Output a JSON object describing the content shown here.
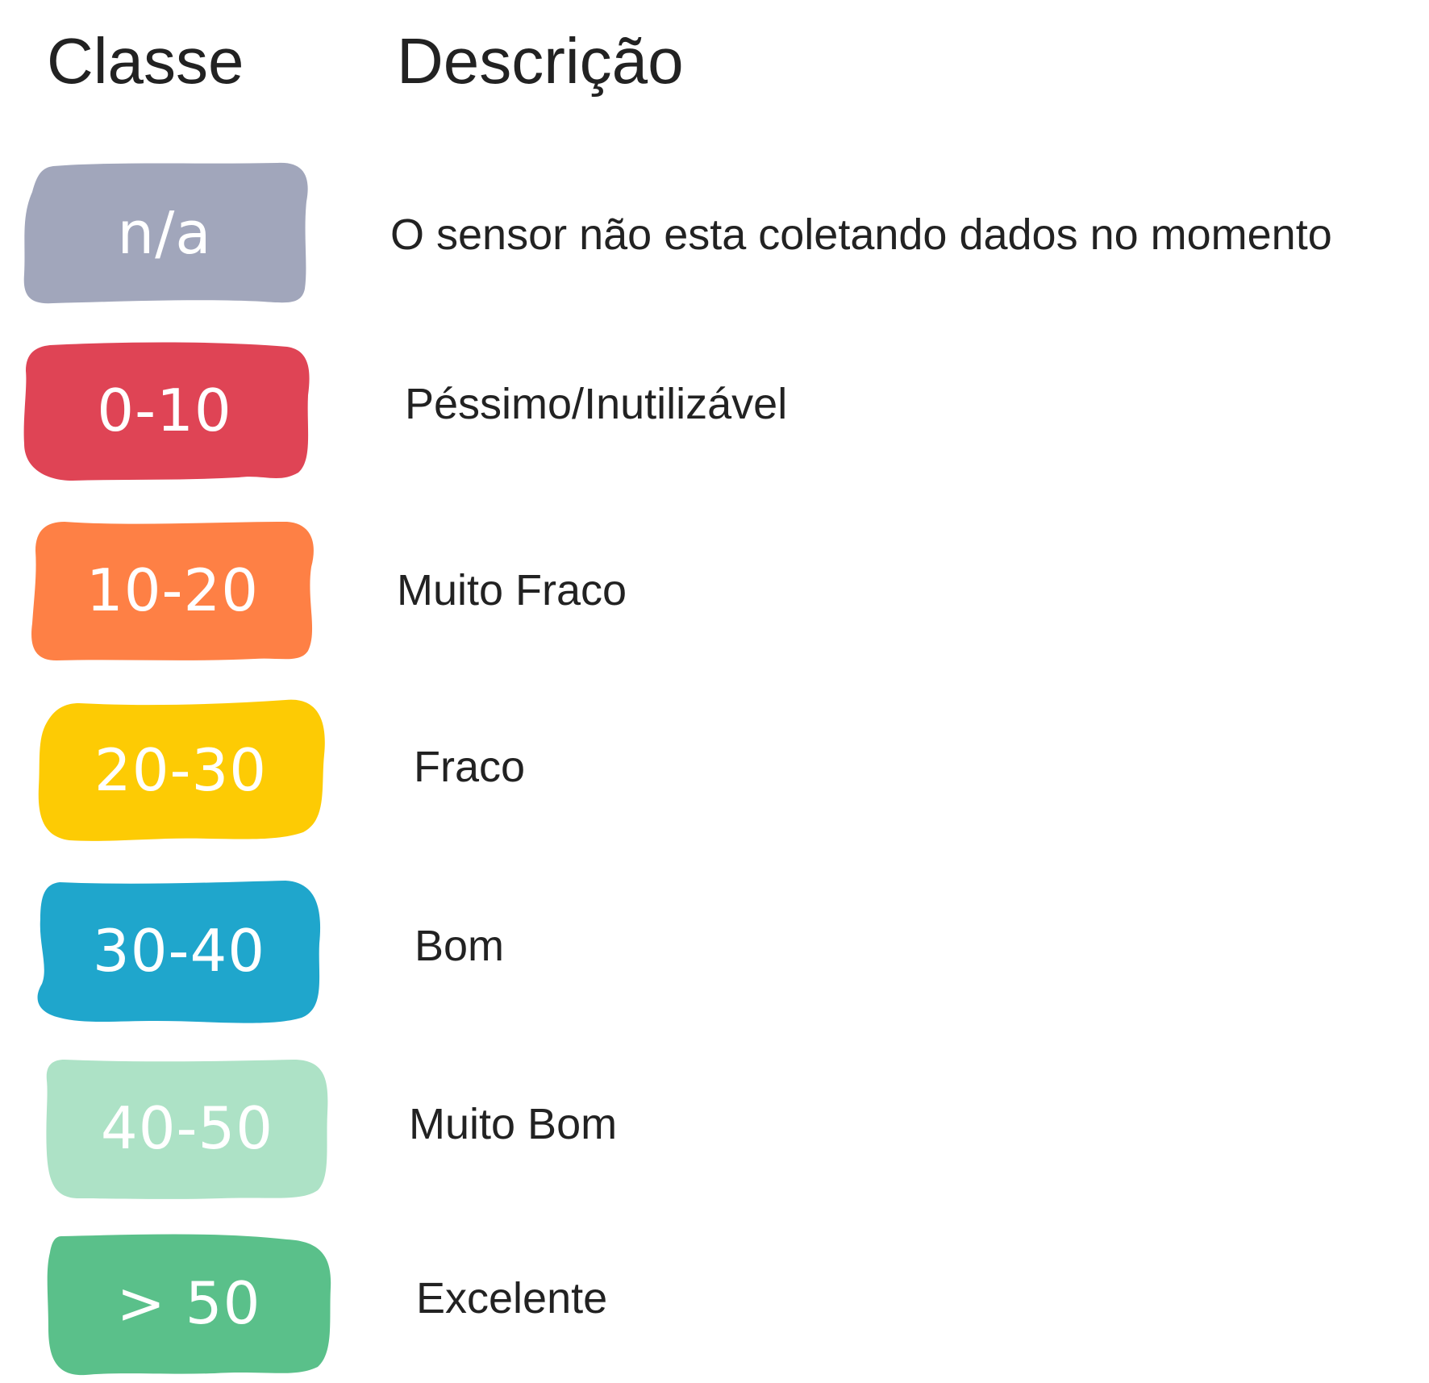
{
  "headers": {
    "class": "Classe",
    "description": "Descrição"
  },
  "rows": [
    {
      "class": "n/a",
      "description": "O sensor não esta coletando dados no momento",
      "color": "#a1a6bb"
    },
    {
      "class": "0-10",
      "description": "Péssimo/Inutilizável",
      "color": "#df4455"
    },
    {
      "class": "10-20",
      "description": "Muito Fraco",
      "color": "#fe8045"
    },
    {
      "class": "20-30",
      "description": "Fraco",
      "color": "#fdcb04"
    },
    {
      "class": "30-40",
      "description": "Bom",
      "color": "#1fa6cc"
    },
    {
      "class": "40-50",
      "description": "Muito Bom",
      "color": "#ade2c6"
    },
    {
      "class": "> 50",
      "description": "Excelente",
      "color": "#5ac08a"
    }
  ]
}
